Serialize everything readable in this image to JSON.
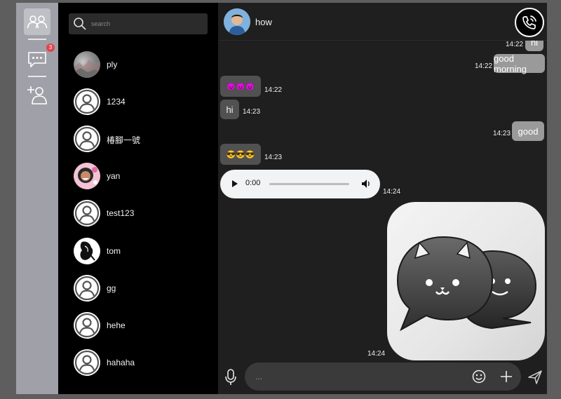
{
  "rail": {
    "chat_badge": "3"
  },
  "search": {
    "placeholder": "search"
  },
  "contacts": [
    {
      "name": "ply"
    },
    {
      "name": "1234"
    },
    {
      "name": "椿腳一號"
    },
    {
      "name": "yan"
    },
    {
      "name": "test123"
    },
    {
      "name": "tom"
    },
    {
      "name": "gg"
    },
    {
      "name": "hehe"
    },
    {
      "name": "hahaha"
    }
  ],
  "chat": {
    "contact_name": "how",
    "messages": [
      {
        "dir": "out",
        "text": "hi",
        "time": "14:22"
      },
      {
        "dir": "out",
        "text": "good morning",
        "time": "14:22"
      },
      {
        "dir": "in",
        "text": "😈😈😈",
        "time": "14:22"
      },
      {
        "dir": "in",
        "text": "hi",
        "time": "14:23"
      },
      {
        "dir": "out",
        "text": "good",
        "time": "14:23"
      },
      {
        "dir": "in",
        "text": "😎😎😎",
        "time": "14:23"
      },
      {
        "dir": "in",
        "type": "audio",
        "current_time": "0:00",
        "time": "14:24"
      },
      {
        "dir": "out",
        "type": "sticker",
        "time": "14:24"
      }
    ]
  },
  "composer": {
    "placeholder": "..."
  },
  "colors": {
    "rail": "#a0a0a8",
    "contacts_bg": "#000000",
    "chat_bg": "#1f1f1f",
    "incoming_bubble": "#515151",
    "outgoing_bubble": "#9a9a9a",
    "badge": "#e0444e"
  },
  "icons": {
    "rail_contacts": "users-icon",
    "rail_chats": "chat-icon",
    "rail_add_friend": "add-user-icon",
    "call": "phone-call-icon",
    "mic": "microphone-icon",
    "emoji": "smiley-icon",
    "attach": "plus-icon",
    "send": "send-icon"
  }
}
